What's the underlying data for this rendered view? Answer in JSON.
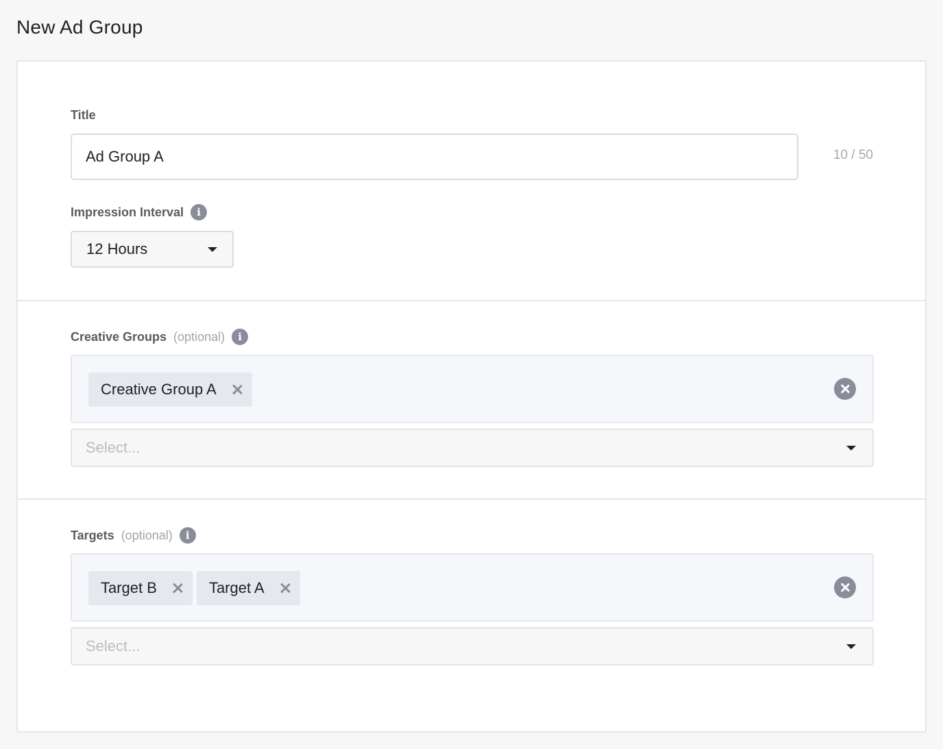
{
  "page": {
    "title": "New Ad Group"
  },
  "title_field": {
    "label": "Title",
    "value": "Ad Group A",
    "char_count": "10 / 50"
  },
  "impression_interval": {
    "label": "Impression Interval",
    "info_icon": "info-icon",
    "selected": "12 Hours"
  },
  "creative_groups": {
    "label": "Creative Groups",
    "optional": "(optional)",
    "info_icon": "info-icon",
    "tags": [
      "Creative Group A"
    ],
    "select_placeholder": "Select..."
  },
  "targets": {
    "label": "Targets",
    "optional": "(optional)",
    "info_icon": "info-icon",
    "tags": [
      "Target B",
      "Target A"
    ],
    "select_placeholder": "Select..."
  },
  "colors": {
    "page_bg": "#f7f7f7",
    "card_bg": "#ffffff",
    "tag_bg": "#e6e8ef",
    "icon_gray": "#8a8d99",
    "tag_box_bg": "#f5f7fb"
  }
}
